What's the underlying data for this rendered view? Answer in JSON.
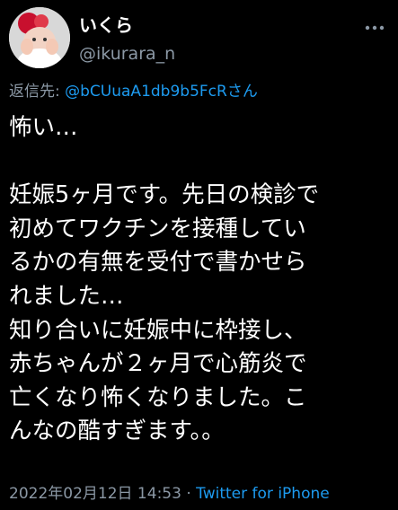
{
  "tweet": {
    "author": {
      "display_name": "いくら",
      "handle": "@ikurara_n"
    },
    "reply": {
      "prefix": "返信先: ",
      "target": "@bCUuaA1db9b5FcRさん"
    },
    "body_lines": [
      "怖い…",
      "",
      "妊娠5ヶ月です。先日の検診で",
      "初めてワクチンを接種してい",
      "るかの有無を受付で書かせら",
      "れました…",
      "知り合いに妊娠中に枠接し、",
      "赤ちゃんが２ヶ月で心筋炎で",
      "亡くなり怖くなりました。こ",
      "んなの酷すぎます。。"
    ],
    "timestamp": "2022年02月12日 14:53",
    "separator": " · ",
    "source": "Twitter for iPhone"
  },
  "icons": {
    "more": "more-horizontal-icon",
    "avatar": "avatar"
  },
  "colors": {
    "background": "#000000",
    "text": "#ffffff",
    "secondary": "#8b98a5",
    "accent": "#1d9bf0"
  }
}
